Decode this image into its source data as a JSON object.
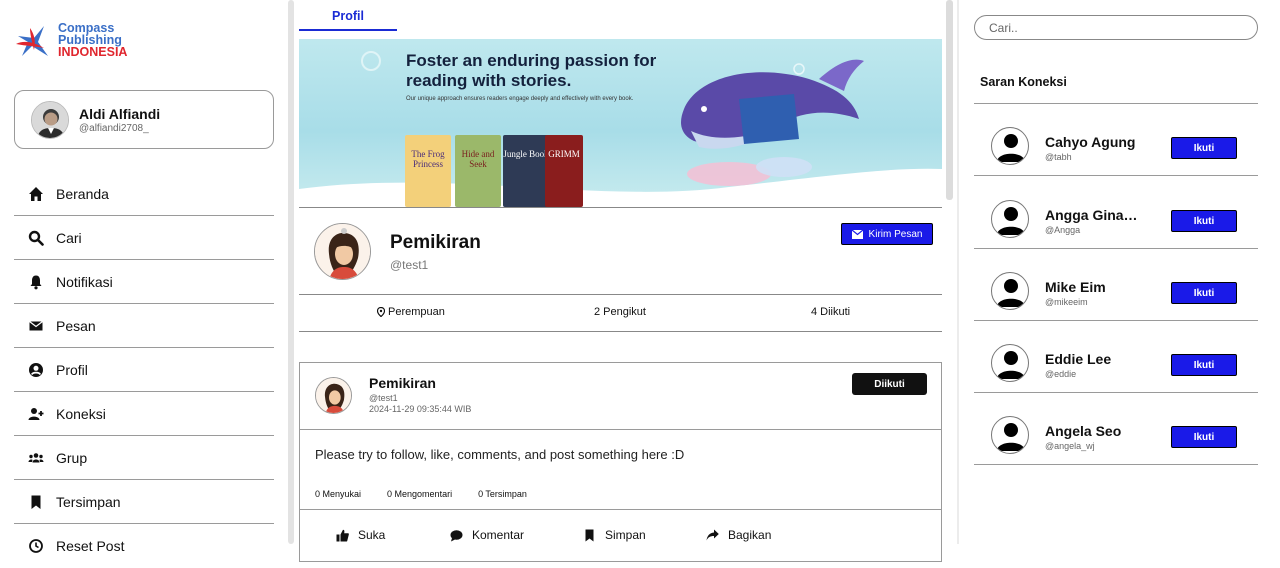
{
  "brand": {
    "line1": "Compass",
    "line2": "Publishing",
    "line3": "INDONESIA"
  },
  "user": {
    "name": "Aldi Alfiandi",
    "handle": "@alfiandi2708_"
  },
  "nav": [
    {
      "label": "Beranda",
      "icon": "home-icon"
    },
    {
      "label": "Cari",
      "icon": "search-icon"
    },
    {
      "label": "Notifikasi",
      "icon": "bell-icon"
    },
    {
      "label": "Pesan",
      "icon": "envelope-icon"
    },
    {
      "label": "Profil",
      "icon": "user-circle-icon"
    },
    {
      "label": "Koneksi",
      "icon": "user-plus-icon"
    },
    {
      "label": "Grup",
      "icon": "users-icon"
    },
    {
      "label": "Tersimpan",
      "icon": "bookmark-icon"
    },
    {
      "label": "Reset Post",
      "icon": "reset-icon"
    }
  ],
  "tab": {
    "label": "Profil"
  },
  "banner": {
    "title": "Foster an enduring passion for reading with stories.",
    "subtitle": "Our unique approach ensures readers engage deeply and effectively with every book.",
    "books": [
      "The Frog Princess",
      "Hide and Seek",
      "Jungle Book",
      "GRIMM"
    ]
  },
  "profile": {
    "name": "Pemikiran",
    "handle": "@test1",
    "message_button": "Kirim Pesan",
    "gender": "Perempuan",
    "followers": "2 Pengikut",
    "following": "4 Diikuti"
  },
  "post": {
    "name": "Pemikiran",
    "handle": "@test1",
    "timestamp": "2024-11-29 09:35:44 WIB",
    "follow_button": "Diikuti",
    "body": "Please try to follow, like, comments, and post something here :D",
    "likes": "0 Menyukai",
    "comments": "0 Mengomentari",
    "saves": "0 Tersimpan",
    "actions": {
      "like": "Suka",
      "comment": "Komentar",
      "save": "Simpan",
      "share": "Bagikan"
    }
  },
  "search": {
    "placeholder": "Cari.."
  },
  "suggestions": {
    "title": "Saran Koneksi",
    "button_label": "Ikuti",
    "items": [
      {
        "name": "Cahyo Agung",
        "handle": "@tabh"
      },
      {
        "name": "Angga Gina…",
        "handle": "@Angga"
      },
      {
        "name": "Mike Eim",
        "handle": "@mikeeim"
      },
      {
        "name": "Eddie Lee",
        "handle": "@eddie"
      },
      {
        "name": "Angela Seo",
        "handle": "@angela_wj"
      }
    ]
  },
  "colors": {
    "primary": "#1a1ae8",
    "brand_blue": "#3a6fc7",
    "brand_red": "#e0262e",
    "dark_button": "#111111"
  }
}
